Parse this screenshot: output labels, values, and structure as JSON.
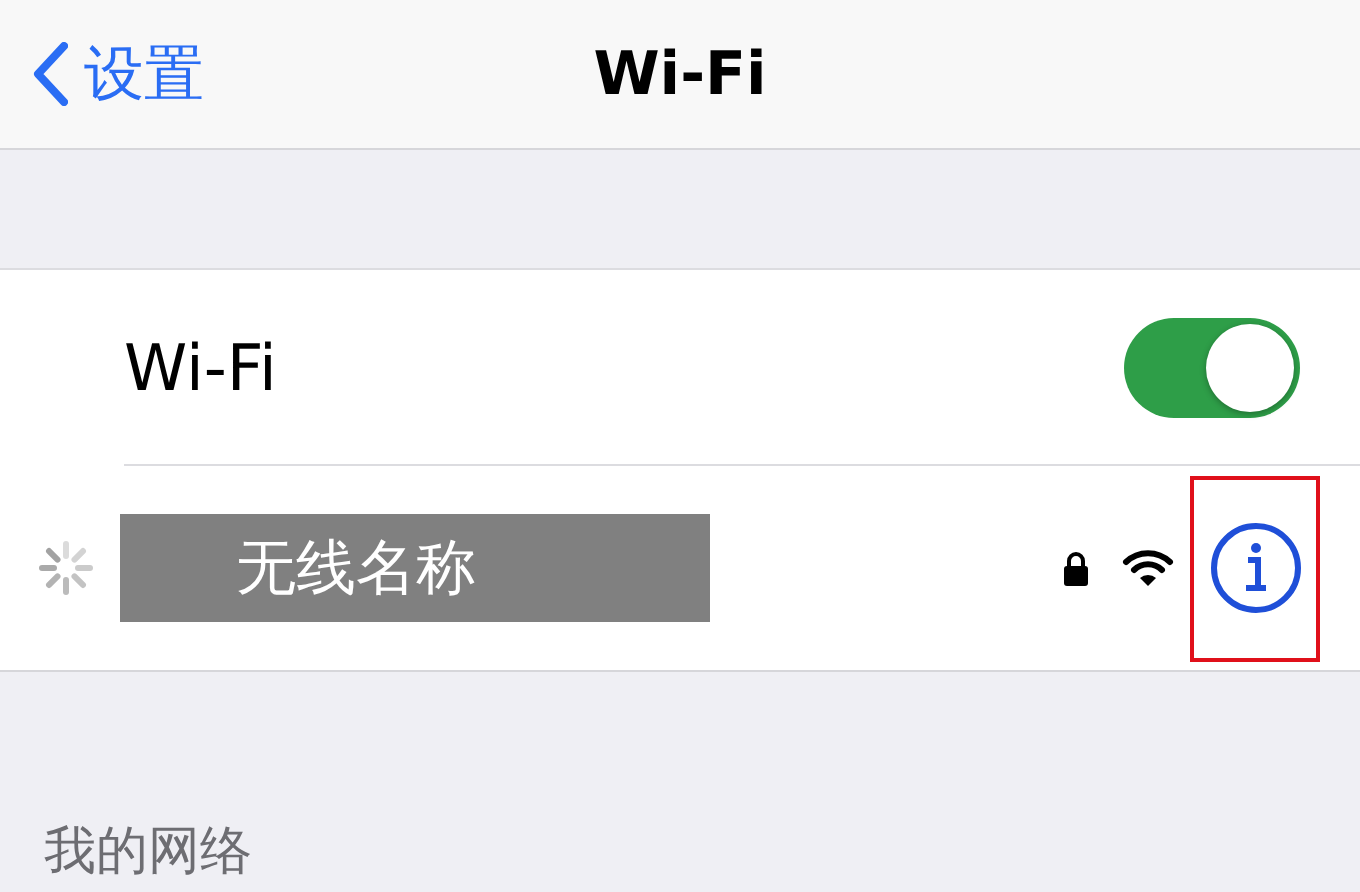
{
  "nav": {
    "back_label": "设置",
    "title": "Wi-Fi"
  },
  "wifi_toggle": {
    "label": "Wi-Fi",
    "on": true
  },
  "networks": [
    {
      "name": "无线名称",
      "connecting": true,
      "secured": true,
      "info_highlighted": true
    }
  ],
  "section_header": "我的网络"
}
